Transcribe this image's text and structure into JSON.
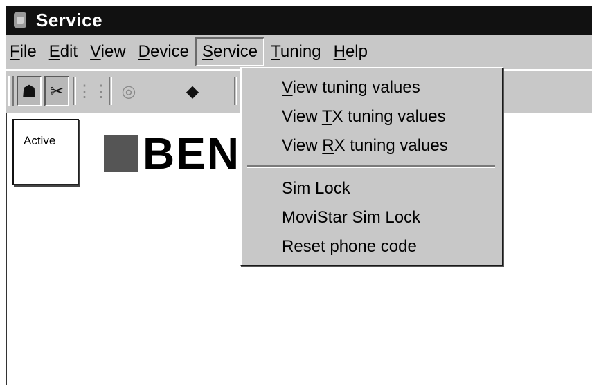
{
  "window": {
    "title": "Service"
  },
  "menubar": {
    "items": [
      {
        "pre": "",
        "key": "F",
        "post": "ile"
      },
      {
        "pre": "",
        "key": "E",
        "post": "dit"
      },
      {
        "pre": "",
        "key": "V",
        "post": "iew"
      },
      {
        "pre": "",
        "key": "D",
        "post": "evice"
      },
      {
        "pre": "",
        "key": "S",
        "post": "ervice"
      },
      {
        "pre": "",
        "key": "T",
        "post": "uning"
      },
      {
        "pre": "",
        "key": "H",
        "post": "elp"
      }
    ]
  },
  "toolbar": {
    "buttons": [
      {
        "icon": "connect-icon",
        "glyph": "☗",
        "state": "pressed"
      },
      {
        "icon": "disconnect-icon",
        "glyph": "✂",
        "state": "pressed"
      },
      {
        "icon": "equalizer-icon",
        "glyph": "⋮⋮",
        "state": "disabled"
      },
      {
        "icon": "lifebuoy-icon",
        "glyph": "◎",
        "state": "disabled"
      },
      {
        "icon": "eraser-icon",
        "glyph": "◆",
        "state": "normal"
      }
    ]
  },
  "client": {
    "active_label": "Active",
    "logo_text": "BEN"
  },
  "service_menu": {
    "group1": [
      {
        "pre": "",
        "key": "V",
        "post": "iew tuning values"
      },
      {
        "pre": "View ",
        "key": "T",
        "post": "X tuning values"
      },
      {
        "pre": "View ",
        "key": "R",
        "post": "X tuning values"
      }
    ],
    "group2": [
      {
        "text": "Sim Lock"
      },
      {
        "text": "MoviStar Sim Lock"
      },
      {
        "text": "Reset phone code"
      }
    ]
  }
}
